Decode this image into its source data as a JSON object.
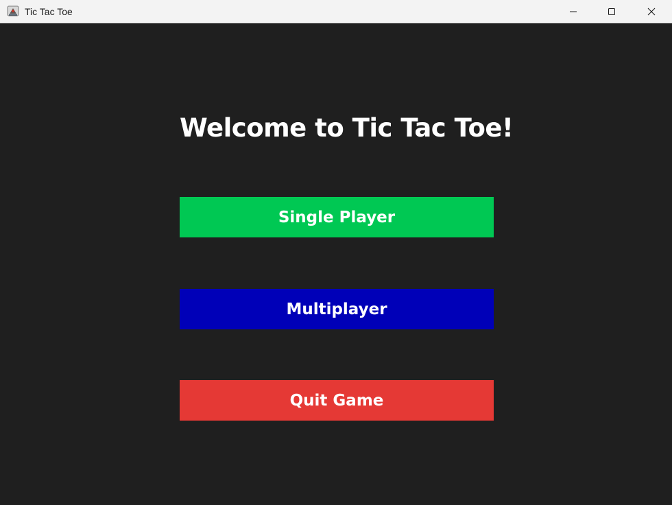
{
  "window": {
    "title": "Tic Tac Toe",
    "icon": "java-app-icon",
    "controls": {
      "minimize_icon": "minimize-icon",
      "maximize_icon": "maximize-icon",
      "close_icon": "close-icon"
    }
  },
  "main": {
    "heading": "Welcome to Tic Tac Toe!",
    "buttons": {
      "single_player": {
        "label": "Single Player",
        "color": "#00c853"
      },
      "multiplayer": {
        "label": "Multiplayer",
        "color": "#0000b8"
      },
      "quit": {
        "label": "Quit Game",
        "color": "#e53935"
      }
    }
  },
  "colors": {
    "background": "#1f1f1f",
    "titlebar": "#f3f3f3",
    "text": "#ffffff"
  }
}
